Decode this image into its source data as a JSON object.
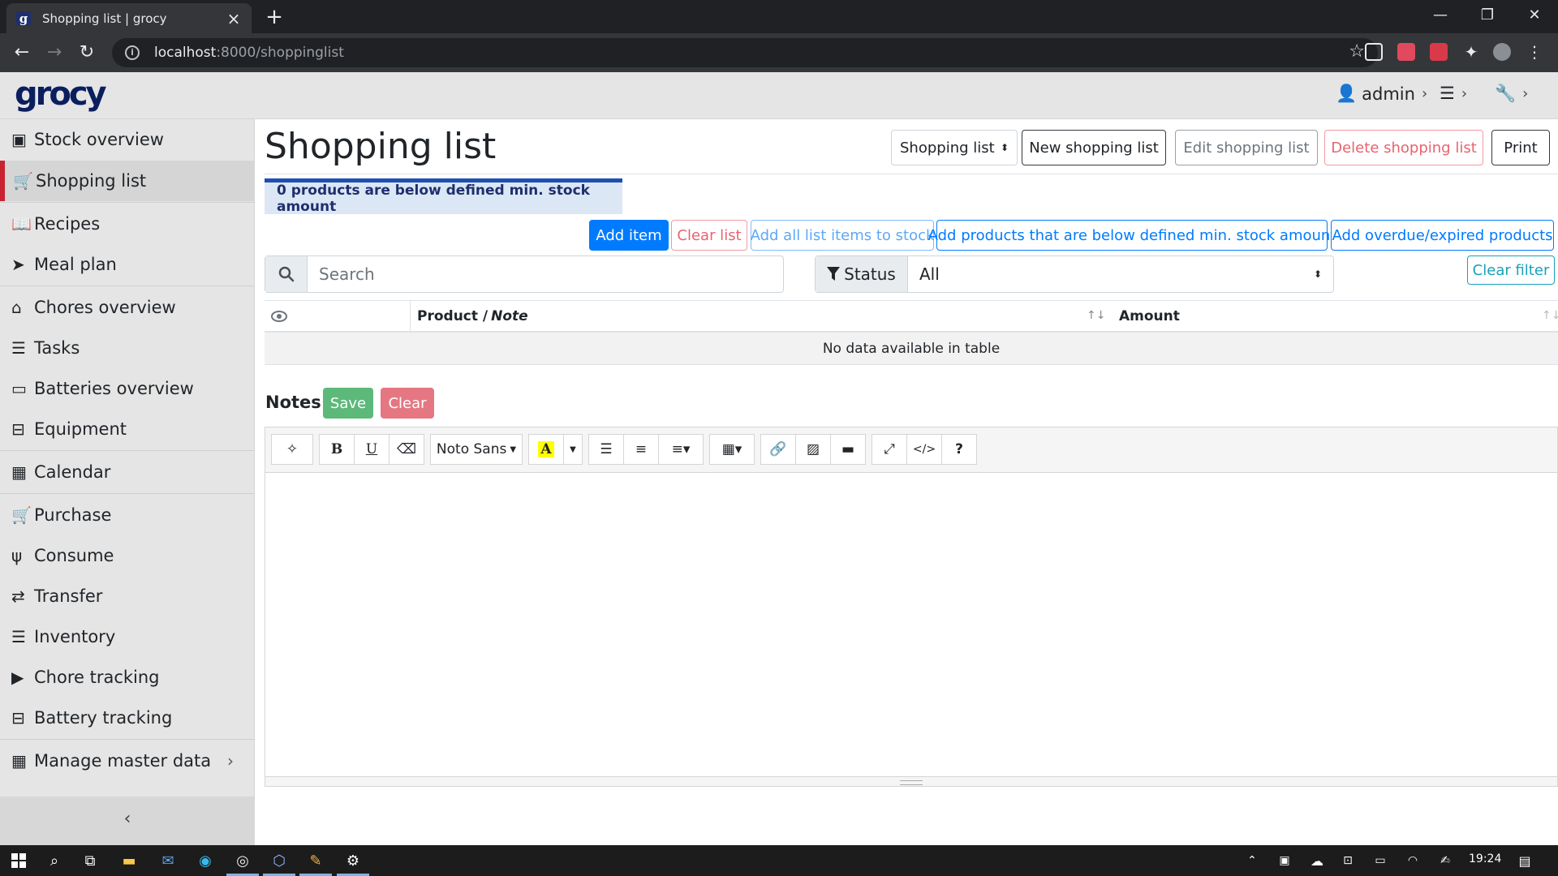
{
  "browser": {
    "tab_title": "Shopping list | grocy",
    "tab_favicon": "g",
    "close_icon": "×",
    "new_tab": "+",
    "url_host": "localhost",
    "url_path": ":8000/shoppinglist",
    "window_controls": [
      "—",
      "❐",
      "✕"
    ]
  },
  "app": {
    "logo": "grocy",
    "user": "admin",
    "accent": "#c82333"
  },
  "sidebar": {
    "items": [
      {
        "label": "Stock overview",
        "icon": "box-icon",
        "glyph": "▣"
      },
      {
        "label": "Shopping list",
        "icon": "cart-icon",
        "glyph": "🛒"
      },
      {
        "label": "Recipes",
        "icon": "book-icon",
        "glyph": "📖"
      },
      {
        "label": "Meal plan",
        "icon": "paper-plane-icon",
        "glyph": "➤"
      },
      {
        "label": "Chores overview",
        "icon": "home-icon",
        "glyph": "⌂"
      },
      {
        "label": "Tasks",
        "icon": "tasks-icon",
        "glyph": "☰"
      },
      {
        "label": "Batteries overview",
        "icon": "battery-icon",
        "glyph": "▭"
      },
      {
        "label": "Equipment",
        "icon": "toolbox-icon",
        "glyph": "⊟"
      },
      {
        "label": "Calendar",
        "icon": "calendar-icon",
        "glyph": "▦"
      },
      {
        "label": "Purchase",
        "icon": "cart-plus-icon",
        "glyph": "🛒"
      },
      {
        "label": "Consume",
        "icon": "utensils-icon",
        "glyph": "ψ"
      },
      {
        "label": "Transfer",
        "icon": "exchange-icon",
        "glyph": "⇄"
      },
      {
        "label": "Inventory",
        "icon": "list-icon",
        "glyph": "☰"
      },
      {
        "label": "Chore tracking",
        "icon": "play-icon",
        "glyph": "▶"
      },
      {
        "label": "Battery tracking",
        "icon": "car-battery-icon",
        "glyph": "⊟"
      },
      {
        "label": "Manage master data",
        "icon": "table-icon",
        "glyph": "▦"
      }
    ],
    "collapse_glyph": "‹"
  },
  "main": {
    "title": "Shopping list",
    "list_select": "Shopping list",
    "new_list": "New shopping list",
    "edit_list": "Edit shopping list",
    "delete_list": "Delete shopping list",
    "print": "Print",
    "alert": "0 products are below defined min. stock amount",
    "add_item": "Add item",
    "clear_list": "Clear list",
    "add_all_to_stock": "Add all list items to stock",
    "add_below_min": "Add products that are below defined min. stock amount",
    "add_overdue": "Add overdue/expired products",
    "search_placeholder": "Search",
    "status_label": "Status",
    "status_value": "All",
    "clear_filter": "Clear filter",
    "table": {
      "col_product": "Product / ",
      "col_note": "Note",
      "col_amount": "Amount",
      "empty": "No data available in table"
    },
    "notes": {
      "title": "Notes",
      "save": "Save",
      "clear": "Clear",
      "font_name": "Noto Sans"
    }
  },
  "taskbar": {
    "time": "19:24"
  }
}
